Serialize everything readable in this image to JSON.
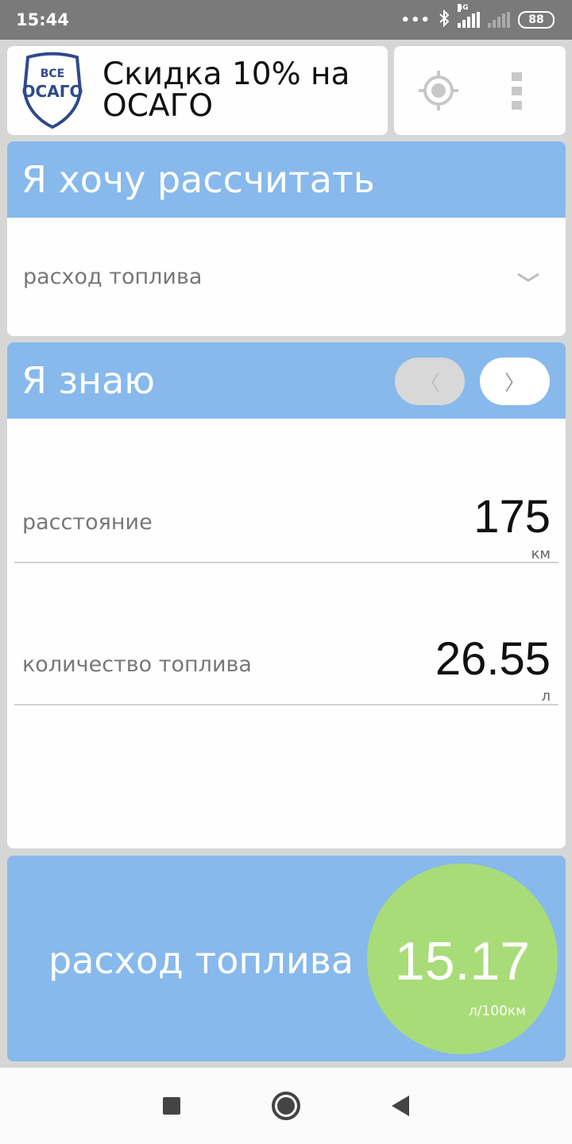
{
  "status_bar": {
    "time": "15:44",
    "network_label": "4G",
    "battery": "88",
    "icons": [
      "dots-icon",
      "bluetooth-icon",
      "signal-4g-icon",
      "signal-no-sim-icon",
      "battery-icon"
    ]
  },
  "ad": {
    "logo_top": "ВСЕ",
    "logo_main": "ОСАГО",
    "text": "Скидка 10% на ОСАГО"
  },
  "toolbar": {
    "icons": [
      "locate-icon",
      "more-vert-icon"
    ]
  },
  "calc": {
    "title": "Я хочу рассчитать",
    "selected": "расход топлива"
  },
  "known": {
    "title": "Я знаю",
    "prev_glyph": "〈",
    "next_glyph": "〉",
    "fields": [
      {
        "label": "расстояние",
        "value": "175",
        "unit": "км"
      },
      {
        "label": "количество топлива",
        "value": "26.55",
        "unit": "л"
      }
    ]
  },
  "result": {
    "label": "расход топлива",
    "value": "15.17",
    "unit": "л/100км"
  },
  "colors": {
    "status_bar": "#7a7a7a",
    "accent_blue": "#87b9ec",
    "result_green": "#a8dc78",
    "logo_blue": "#2f4a8a"
  }
}
